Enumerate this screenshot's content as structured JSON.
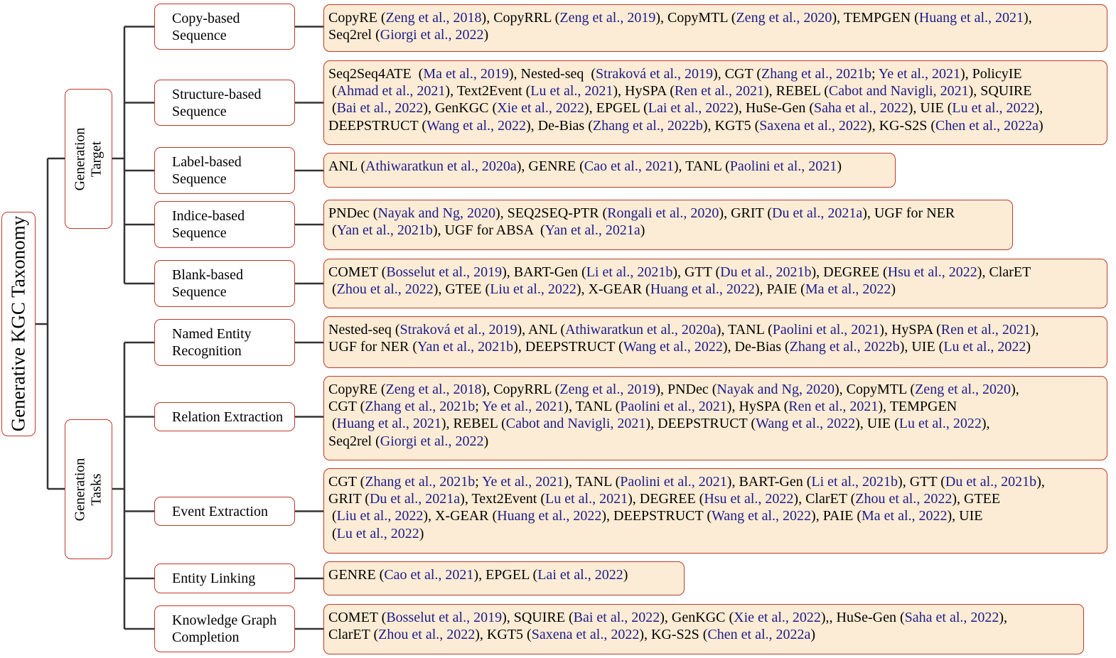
{
  "colors": {
    "border": "#c0392b",
    "leaf_fill": "#fcecd5",
    "citation": "#1c1c8a",
    "connector": "#333333"
  },
  "root": {
    "label": "Generative KGC Taxonomy"
  },
  "branches": [
    {
      "label_lines": [
        "Generation",
        "Target"
      ],
      "categories": [
        {
          "label_lines": [
            "Copy-based",
            "Sequence"
          ],
          "leaf_lines": [
            [
              [
                "CopyRE (",
                0
              ],
              [
                "Zeng et al., 2018",
                1
              ],
              [
                "), CopyRRL (",
                0
              ],
              [
                "Zeng et al., 2019",
                1
              ],
              [
                "), CopyMTL (",
                0
              ],
              [
                "Zeng et al., 2020",
                1
              ],
              [
                "), TEMPGEN (",
                0
              ],
              [
                "Huang et al., 2021",
                1
              ],
              [
                "),",
                0
              ]
            ],
            [
              [
                "Seq2rel (",
                0
              ],
              [
                "Giorgi et al., 2022",
                1
              ],
              [
                ")",
                0
              ]
            ]
          ]
        },
        {
          "label_lines": [
            "Structure-based",
            "Sequence"
          ],
          "leaf_lines": [
            [
              [
                "Seq2Seq4ATE  (",
                0
              ],
              [
                "Ma et al., 2019",
                1
              ],
              [
                "), Nested-seq  (",
                0
              ],
              [
                "Straková et al., 2019",
                1
              ],
              [
                "), CGT (",
                0
              ],
              [
                "Zhang et al., 2021b",
                1
              ],
              [
                "; ",
                0
              ],
              [
                "Ye et al., 2021",
                1
              ],
              [
                "), PolicyIE",
                0
              ]
            ],
            [
              [
                " (",
                0
              ],
              [
                "Ahmad et al., 2021",
                1
              ],
              [
                "), Text2Event (",
                0
              ],
              [
                "Lu et al., 2021",
                1
              ],
              [
                "), HySPA (",
                0
              ],
              [
                "Ren et al., 2021",
                1
              ],
              [
                "), REBEL (",
                0
              ],
              [
                "Cabot and Navigli, 2021",
                1
              ],
              [
                "), SQUIRE",
                0
              ]
            ],
            [
              [
                " (",
                0
              ],
              [
                "Bai et al., 2022",
                1
              ],
              [
                "), GenKGC (",
                0
              ],
              [
                "Xie et al., 2022",
                1
              ],
              [
                "), EPGEL (",
                0
              ],
              [
                "Lai et al., 2022",
                1
              ],
              [
                "), HuSe-Gen (",
                0
              ],
              [
                "Saha et al., 2022",
                1
              ],
              [
                "), UIE (",
                0
              ],
              [
                "Lu et al., 2022",
                1
              ],
              [
                "),",
                0
              ]
            ],
            [
              [
                "DEEPSTRUCT (",
                0
              ],
              [
                "Wang et al., 2022",
                1
              ],
              [
                "), De-Bias (",
                0
              ],
              [
                "Zhang et al., 2022b",
                1
              ],
              [
                "), KGT5 (",
                0
              ],
              [
                "Saxena et al., 2022",
                1
              ],
              [
                "), KG-S2S (",
                0
              ],
              [
                "Chen et al., 2022a",
                1
              ],
              [
                ")",
                0
              ]
            ]
          ]
        },
        {
          "label_lines": [
            "Label-based",
            "Sequence"
          ],
          "leaf_lines": [
            [
              [
                "ANL (",
                0
              ],
              [
                "Athiwaratkun et al., 2020a",
                1
              ],
              [
                "), GENRE (",
                0
              ],
              [
                "Cao et al., 2021",
                1
              ],
              [
                "), TANL (",
                0
              ],
              [
                "Paolini et al., 2021",
                1
              ],
              [
                ")",
                0
              ]
            ]
          ]
        },
        {
          "label_lines": [
            "Indice-based",
            "Sequence"
          ],
          "leaf_lines": [
            [
              [
                "PNDec (",
                0
              ],
              [
                "Nayak and Ng, 2020",
                1
              ],
              [
                "), SEQ2SEQ-PTR (",
                0
              ],
              [
                "Rongali et al., 2020",
                1
              ],
              [
                "), GRIT (",
                0
              ],
              [
                "Du et al., 2021a",
                1
              ],
              [
                "), UGF for NER",
                0
              ]
            ],
            [
              [
                " (",
                0
              ],
              [
                "Yan et al., 2021b",
                1
              ],
              [
                "), UGF for ABSA  (",
                0
              ],
              [
                "Yan et al., 2021a",
                1
              ],
              [
                ")",
                0
              ]
            ]
          ]
        },
        {
          "label_lines": [
            "Blank-based",
            "Sequence"
          ],
          "leaf_lines": [
            [
              [
                "COMET (",
                0
              ],
              [
                "Bosselut et al., 2019",
                1
              ],
              [
                "), BART-Gen (",
                0
              ],
              [
                "Li et al., 2021b",
                1
              ],
              [
                "), GTT (",
                0
              ],
              [
                "Du et al., 2021b",
                1
              ],
              [
                "), DEGREE (",
                0
              ],
              [
                "Hsu et al., 2022",
                1
              ],
              [
                "), ClarET",
                0
              ]
            ],
            [
              [
                " (",
                0
              ],
              [
                "Zhou et al., 2022",
                1
              ],
              [
                "), GTEE (",
                0
              ],
              [
                "Liu et al., 2022",
                1
              ],
              [
                "), X-GEAR (",
                0
              ],
              [
                "Huang et al., 2022",
                1
              ],
              [
                "), PAIE (",
                0
              ],
              [
                "Ma et al., 2022",
                1
              ],
              [
                ")",
                0
              ]
            ]
          ]
        }
      ]
    },
    {
      "label_lines": [
        "Generation",
        "Tasks"
      ],
      "categories": [
        {
          "label_lines": [
            "Named Entity",
            "Recognition"
          ],
          "leaf_lines": [
            [
              [
                "Nested-seq (",
                0
              ],
              [
                "Straková et al., 2019",
                1
              ],
              [
                "), ANL (",
                0
              ],
              [
                "Athiwaratkun et al., 2020a",
                1
              ],
              [
                "), TANL (",
                0
              ],
              [
                "Paolini et al., 2021",
                1
              ],
              [
                "), HySPA (",
                0
              ],
              [
                "Ren et al., 2021",
                1
              ],
              [
                "),",
                0
              ]
            ],
            [
              [
                "UGF for NER (",
                0
              ],
              [
                "Yan et al., 2021b",
                1
              ],
              [
                "), DEEPSTRUCT (",
                0
              ],
              [
                "Wang et al., 2022",
                1
              ],
              [
                "), De-Bias (",
                0
              ],
              [
                "Zhang et al., 2022b",
                1
              ],
              [
                "), UIE (",
                0
              ],
              [
                "Lu et al., 2022",
                1
              ],
              [
                ")",
                0
              ]
            ]
          ]
        },
        {
          "label_lines": [
            "Relation Extraction"
          ],
          "leaf_lines": [
            [
              [
                "CopyRE (",
                0
              ],
              [
                "Zeng et al., 2018",
                1
              ],
              [
                "), CopyRRL (",
                0
              ],
              [
                "Zeng et al., 2019",
                1
              ],
              [
                "), PNDec (",
                0
              ],
              [
                "Nayak and Ng, 2020",
                1
              ],
              [
                "), CopyMTL (",
                0
              ],
              [
                "Zeng et al., 2020",
                1
              ],
              [
                "),",
                0
              ]
            ],
            [
              [
                "CGT (",
                0
              ],
              [
                "Zhang et al., 2021b",
                1
              ],
              [
                "; ",
                0
              ],
              [
                "Ye et al., 2021",
                1
              ],
              [
                "), TANL (",
                0
              ],
              [
                "Paolini et al., 2021",
                1
              ],
              [
                "), HySPA (",
                0
              ],
              [
                "Ren et al., 2021",
                1
              ],
              [
                "), TEMPGEN",
                0
              ]
            ],
            [
              [
                " (",
                0
              ],
              [
                "Huang et al., 2021",
                1
              ],
              [
                "), REBEL (",
                0
              ],
              [
                "Cabot and Navigli, 2021",
                1
              ],
              [
                "), DEEPSTRUCT (",
                0
              ],
              [
                "Wang et al., 2022",
                1
              ],
              [
                "), UIE (",
                0
              ],
              [
                "Lu et al., 2022",
                1
              ],
              [
                "),",
                0
              ]
            ],
            [
              [
                "Seq2rel (",
                0
              ],
              [
                "Giorgi et al., 2022",
                1
              ],
              [
                ")",
                0
              ]
            ]
          ]
        },
        {
          "label_lines": [
            "Event Extraction"
          ],
          "leaf_lines": [
            [
              [
                "CGT (",
                0
              ],
              [
                "Zhang et al., 2021b",
                1
              ],
              [
                "; ",
                0
              ],
              [
                "Ye et al., 2021",
                1
              ],
              [
                "), TANL (",
                0
              ],
              [
                "Paolini et al., 2021",
                1
              ],
              [
                "), BART-Gen (",
                0
              ],
              [
                "Li et al., 2021b",
                1
              ],
              [
                "), GTT (",
                0
              ],
              [
                "Du et al., 2021b",
                1
              ],
              [
                "),",
                0
              ]
            ],
            [
              [
                "GRIT (",
                0
              ],
              [
                "Du et al., 2021a",
                1
              ],
              [
                "), Text2Event (",
                0
              ],
              [
                "Lu et al., 2021",
                1
              ],
              [
                "), DEGREE (",
                0
              ],
              [
                "Hsu et al., 2022",
                1
              ],
              [
                "), ClarET (",
                0
              ],
              [
                "Zhou et al., 2022",
                1
              ],
              [
                "), GTEE",
                0
              ]
            ],
            [
              [
                " (",
                0
              ],
              [
                "Liu et al., 2022",
                1
              ],
              [
                "), X-GEAR (",
                0
              ],
              [
                "Huang et al., 2022",
                1
              ],
              [
                "), DEEPSTRUCT (",
                0
              ],
              [
                "Wang et al., 2022",
                1
              ],
              [
                "), PAIE (",
                0
              ],
              [
                "Ma et al., 2022",
                1
              ],
              [
                "), UIE",
                0
              ]
            ],
            [
              [
                " (",
                0
              ],
              [
                "Lu et al., 2022",
                1
              ],
              [
                ")",
                0
              ]
            ]
          ]
        },
        {
          "label_lines": [
            "Entity Linking"
          ],
          "leaf_lines": [
            [
              [
                "GENRE (",
                0
              ],
              [
                "Cao et al., 2021",
                1
              ],
              [
                "), EPGEL (",
                0
              ],
              [
                "Lai et al., 2022",
                1
              ],
              [
                ")",
                0
              ]
            ]
          ]
        },
        {
          "label_lines": [
            "Knowledge Graph",
            "Completion"
          ],
          "leaf_lines": [
            [
              [
                "COMET (",
                0
              ],
              [
                "Bosselut et al., 2019",
                1
              ],
              [
                "), SQUIRE (",
                0
              ],
              [
                "Bai et al., 2022",
                1
              ],
              [
                "), GenKGC (",
                0
              ],
              [
                "Xie et al., 2022",
                1
              ],
              [
                "),, HuSe-Gen (",
                0
              ],
              [
                "Saha et al., 2022",
                1
              ],
              [
                "),",
                0
              ]
            ],
            [
              [
                "ClarET (",
                0
              ],
              [
                "Zhou et al., 2022",
                1
              ],
              [
                "), KGT5 (",
                0
              ],
              [
                "Saxena et al., 2022",
                1
              ],
              [
                "), KG-S2S (",
                0
              ],
              [
                "Chen et al., 2022a",
                1
              ],
              [
                ")",
                0
              ]
            ]
          ]
        }
      ]
    }
  ]
}
